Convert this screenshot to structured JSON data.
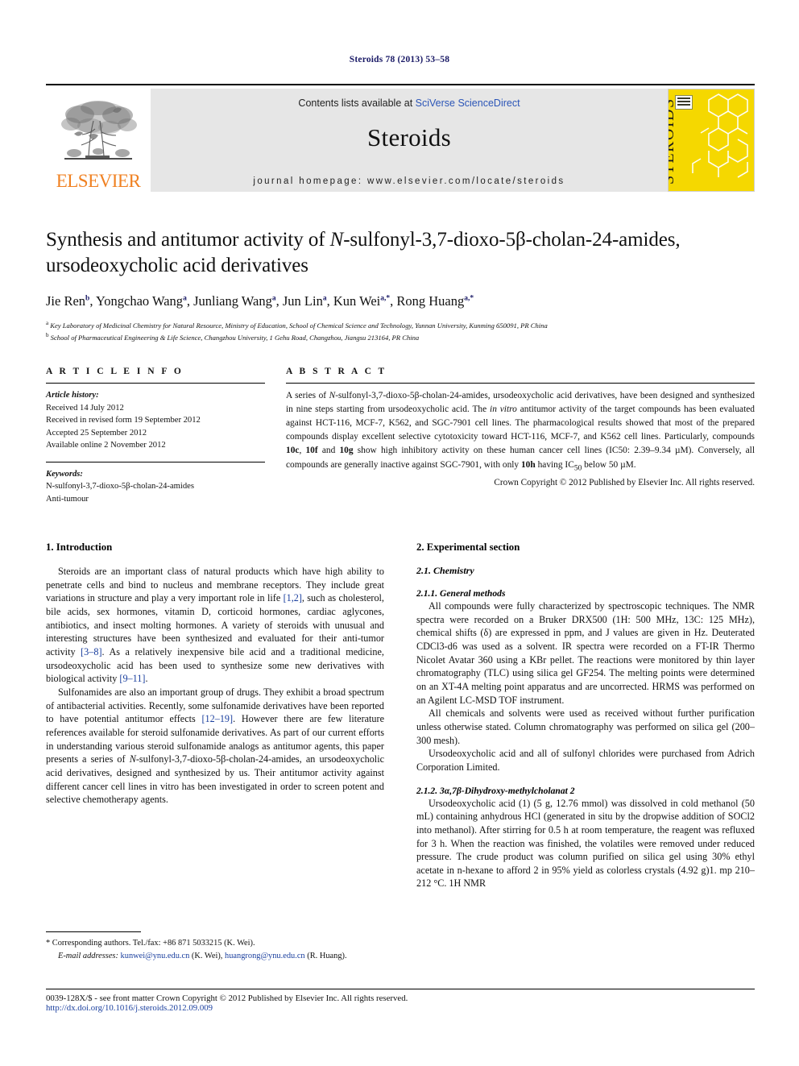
{
  "running_head": "Steroids 78 (2013) 53–58",
  "masthead": {
    "contents_prefix": "Contents lists available at ",
    "contents_link": "SciVerse ScienceDirect",
    "journal_title": "Steroids",
    "homepage": "journal homepage: www.elsevier.com/locate/steroids",
    "publisher_wordmark": "ELSEVIER",
    "cover_title": "STEROIDS"
  },
  "title": {
    "part1": "Synthesis and antitumor activity of ",
    "italic_n": "N",
    "part2": "-sulfonyl-3,7-dioxo-5β-cholan-24-amides, ursodeoxycholic acid derivatives"
  },
  "authors": [
    {
      "name": "Jie Ren",
      "sup": "b"
    },
    {
      "name": "Yongchao Wang",
      "sup": "a"
    },
    {
      "name": "Junliang Wang",
      "sup": "a"
    },
    {
      "name": "Jun Lin",
      "sup": "a"
    },
    {
      "name": "Kun Wei",
      "sup": "a,*"
    },
    {
      "name": "Rong Huang",
      "sup": "a,*"
    }
  ],
  "affiliations": [
    {
      "mark": "a",
      "text": "Key Laboratory of Medicinal Chemistry for Natural Resource, Ministry of Education, School of Chemical Science and Technology, Yunnan University, Kunming 650091, PR China"
    },
    {
      "mark": "b",
      "text": "School of Pharmaceutical Engineering & Life Science, Changzhou University, 1 Gehu Road, Changzhou, Jiangsu 213164, PR China"
    }
  ],
  "article_info": {
    "heading": "A R T I C L E    I N F O",
    "history_label": "Article history:",
    "history": [
      "Received 14 July 2012",
      "Received in revised form 19 September 2012",
      "Accepted 25 September 2012",
      "Available online 2 November 2012"
    ],
    "keywords_label": "Keywords:",
    "keywords": [
      "N-sulfonyl-3,7-dioxo-5β-cholan-24-amides",
      "Anti-tumour"
    ]
  },
  "abstract": {
    "heading": "A B S T R A C T",
    "text_1": "A series of ",
    "text_italic_n": "N",
    "text_2": "-sulfonyl-3,7-dioxo-5β-cholan-24-amides, ursodeoxycholic acid derivatives, have been designed and synthesized in nine steps starting from ursodeoxycholic acid. The ",
    "invitro": "in vitro",
    "text_3": " antitumor activity of the target compounds has been evaluated against HCT-116, MCF-7, K562, and SGC-7901 cell lines. The pharmacological results showed that most of the prepared compounds display excellent selective cytotoxicity toward HCT-116, MCF-7, and K562 cell lines. Particularly, compounds ",
    "cmpd_a": "10c",
    "text_4": ", ",
    "cmpd_b": "10f",
    "text_5": " and ",
    "cmpd_c": "10g",
    "text_6": " show high inhibitory activity on these human cancer cell lines (IC50: 2.39–9.34 µM). Conversely, all compounds are generally inactive against SGC-7901, with only ",
    "cmpd_d": "10h",
    "text_7": " having IC",
    "ic50_sub": "50",
    "text_8": " below 50 µM.",
    "copyright": "Crown Copyright © 2012 Published by Elsevier Inc. All rights reserved."
  },
  "sections": {
    "intro_heading": "1. Introduction",
    "intro_p1_a": "Steroids are an important class of natural products which have high ability to penetrate cells and bind to nucleus and membrane receptors. They include great variations in structure and play a very important role in life ",
    "intro_p1_cite1": "[1,2]",
    "intro_p1_b": ", such as cholesterol, bile acids, sex hormones, vitamin D, corticoid hormones, cardiac aglycones, antibiotics, and insect molting hormones. A variety of steroids with unusual and interesting structures have been synthesized and evaluated for their anti-tumor activity ",
    "intro_p1_cite2": "[3–8]",
    "intro_p1_c": ". As a relatively inexpensive bile acid and a traditional medicine, ursodeoxycholic acid has been used to synthesize some new derivatives with biological activity ",
    "intro_p1_cite3": "[9–11]",
    "intro_p1_d": ".",
    "intro_p2_a": "Sulfonamides are also an important group of drugs. They exhibit a broad spectrum of antibacterial activities. Recently, some sulfonamide derivatives have been reported to have potential antitumor effects ",
    "intro_p2_cite1": "[12–19]",
    "intro_p2_b": ". However there are few literature references available for steroid sulfonamide derivatives. As part of our current efforts in understanding various steroid sulfonamide analogs as antitumor agents, this paper presents a series of ",
    "intro_p2_italic_n": "N",
    "intro_p2_c": "-sulfonyl-3,7-dioxo-5β-cholan-24-amides, an ursodeoxycholic acid derivatives, designed and synthesized by us. Their antitumor activity against different cancer cell lines in vitro has been investigated in order to screen potent and selective chemotherapy agents.",
    "exp_heading": "2. Experimental section",
    "chem_heading": "2.1. Chemistry",
    "general_heading": "2.1.1. General methods",
    "general_p1": "All compounds were fully characterized by spectroscopic techniques. The NMR spectra were recorded on a Bruker DRX500 (1H: 500 MHz, 13C: 125 MHz), chemical shifts (δ) are expressed in ppm, and J values are given in Hz. Deuterated CDCl3-d6 was used as a solvent. IR spectra were recorded on a FT-IR Thermo Nicolet Avatar 360 using a KBr pellet. The reactions were monitored by thin layer chromatography (TLC) using silica gel GF254. The melting points were determined on an XT-4A melting point apparatus and are uncorrected. HRMS was performed on an Agilent LC-MSD TOF instrument.",
    "general_p2": "All chemicals and solvents were used as received without further purification unless otherwise stated. Column chromatography was performed on silica gel (200–300 mesh).",
    "general_p3": "Ursodeoxycholic acid and all of sulfonyl chlorides were purchased from Adrich Corporation Limited.",
    "sub212_heading": "2.1.2. 3α,7β-Dihydroxy-methylcholanat 2",
    "sub212_p1": "Ursodeoxycholic acid (1) (5 g, 12.76 mmol) was dissolved in cold methanol (50 mL) containing anhydrous HCl (generated in situ by the dropwise addition of SOCl2 into methanol). After stirring for 0.5 h at room temperature, the reagent was refluxed for 3 h. When the reaction was finished, the volatiles were removed under reduced pressure. The crude product was column purified on silica gel using 30% ethyl acetate in n-hexane to afford 2 in 95% yield as colorless crystals (4.92 g)1. mp 210–212 °C. 1H NMR"
  },
  "footnotes": {
    "corresponding": "* Corresponding authors. Tel./fax: +86 871 5033215 (K. Wei).",
    "email_label": "E-mail addresses:",
    "email1": "kunwei@ynu.edu.cn",
    "email1_owner": "(K. Wei),",
    "email2": "huangrong@ynu.edu.cn",
    "email2_owner": "(R. Huang)."
  },
  "bottom": {
    "issn": "0039-128X/$ - see front matter Crown Copyright © 2012 Published by Elsevier Inc. All rights reserved.",
    "doi": "http://dx.doi.org/10.1016/j.steroids.2012.09.009"
  },
  "colors": {
    "link_blue": "#2b55b7",
    "cite_blue": "#1a3f9e",
    "elsevier_orange": "#F08122",
    "cover_yellow": "#F5D800",
    "band_grey": "#e6e6e6"
  }
}
